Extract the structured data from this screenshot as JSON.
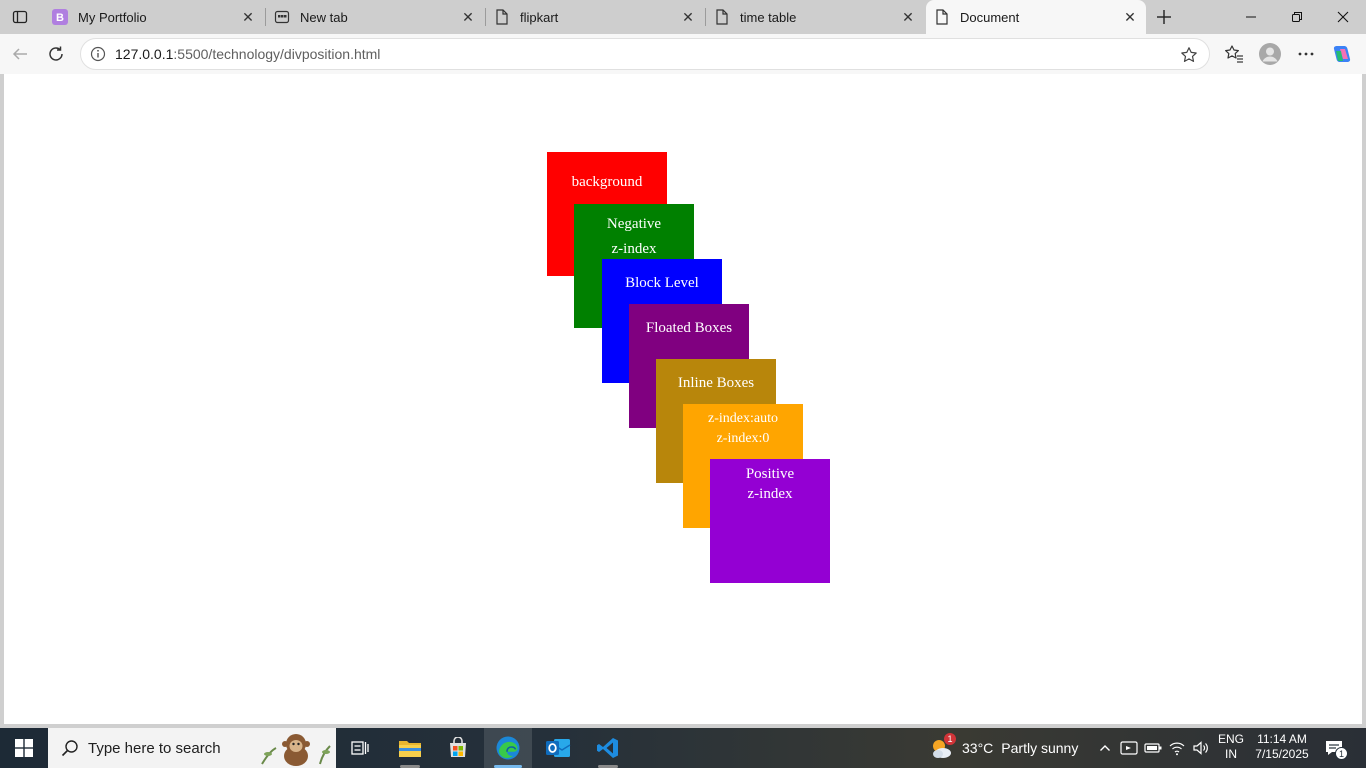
{
  "browser": {
    "tabs": [
      {
        "title": "My Portfolio",
        "icon": "bootstrap-icon"
      },
      {
        "title": "New tab",
        "icon": "newtab-icon"
      },
      {
        "title": "flipkart",
        "icon": "page-icon"
      },
      {
        "title": "time table",
        "icon": "page-icon"
      },
      {
        "title": "Document",
        "icon": "page-icon",
        "active": true
      }
    ],
    "address": {
      "host": "127.0.0.1",
      "rest": ":5500/technology/divposition.html"
    }
  },
  "page": {
    "boxes": [
      {
        "lines": [
          "background"
        ],
        "color": "#ff0000"
      },
      {
        "lines": [
          "Negative",
          "z-index"
        ],
        "color": "#008000"
      },
      {
        "lines": [
          "Block Level"
        ],
        "color": "#0000ff"
      },
      {
        "lines": [
          "Floated Boxes"
        ],
        "color": "#800080"
      },
      {
        "lines": [
          "Inline Boxes"
        ],
        "color": "#b8860b"
      },
      {
        "lines": [
          "z-index:auto",
          "z-index:0"
        ],
        "color": "#ffa500"
      },
      {
        "lines": [
          "Positive",
          "z-index"
        ],
        "color": "#9400d3"
      }
    ]
  },
  "taskbar": {
    "search_placeholder": "Type here to search",
    "weather": {
      "temp": "33°C",
      "desc": "Partly sunny",
      "badge": "1"
    },
    "lang": {
      "line1": "ENG",
      "line2": "IN"
    },
    "clock": {
      "time": "11:14 AM",
      "date": "7/15/2025"
    },
    "notification_count": "1"
  }
}
